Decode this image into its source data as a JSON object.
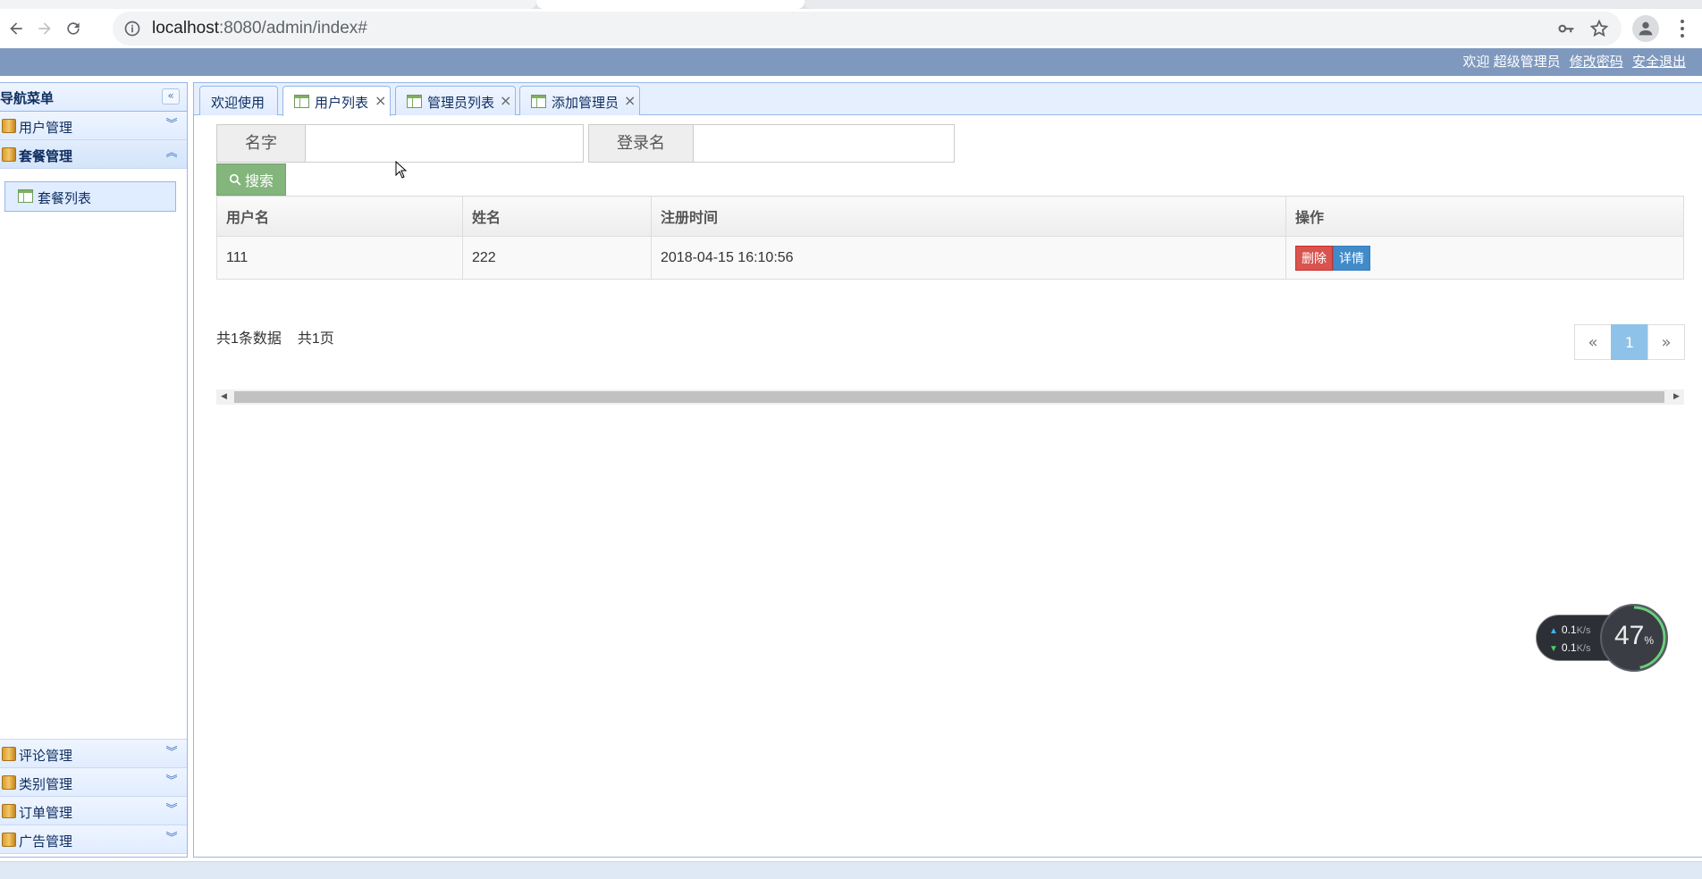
{
  "browser": {
    "url_host": "localhost",
    "url_path": ":8080/admin/index#"
  },
  "header": {
    "welcome": "欢迎",
    "user": "超级管理员",
    "change_password": "修改密码",
    "logout": "安全退出"
  },
  "sidebar": {
    "title": "导航菜单",
    "groups_top": [
      {
        "label": "用户管理"
      },
      {
        "label": "套餐管理"
      }
    ],
    "open_group_item": "套餐列表",
    "groups_bottom": [
      {
        "label": "评论管理"
      },
      {
        "label": "类别管理"
      },
      {
        "label": "订单管理"
      },
      {
        "label": "广告管理"
      }
    ]
  },
  "tabs": [
    {
      "label": "欢迎使用"
    },
    {
      "label": "用户列表"
    },
    {
      "label": "管理员列表"
    },
    {
      "label": "添加管理员"
    }
  ],
  "search": {
    "name_label": "名字",
    "login_label": "登录名",
    "button": "搜索"
  },
  "table": {
    "headers": [
      "用户名",
      "姓名",
      "注册时间",
      "操作"
    ],
    "rows": [
      {
        "username": "111",
        "name": "222",
        "registered": "2018-04-15 16:10:56",
        "delete": "删除",
        "detail": "详情"
      }
    ]
  },
  "summary": {
    "total_records": "共1条数据",
    "total_pages": "共1页"
  },
  "pagination": {
    "prev": "«",
    "current": "1",
    "next": "»"
  },
  "net_widget": {
    "upload": "0.1",
    "download": "0.1",
    "unit": "K/s",
    "cpu": "47",
    "cpu_unit": "%"
  }
}
